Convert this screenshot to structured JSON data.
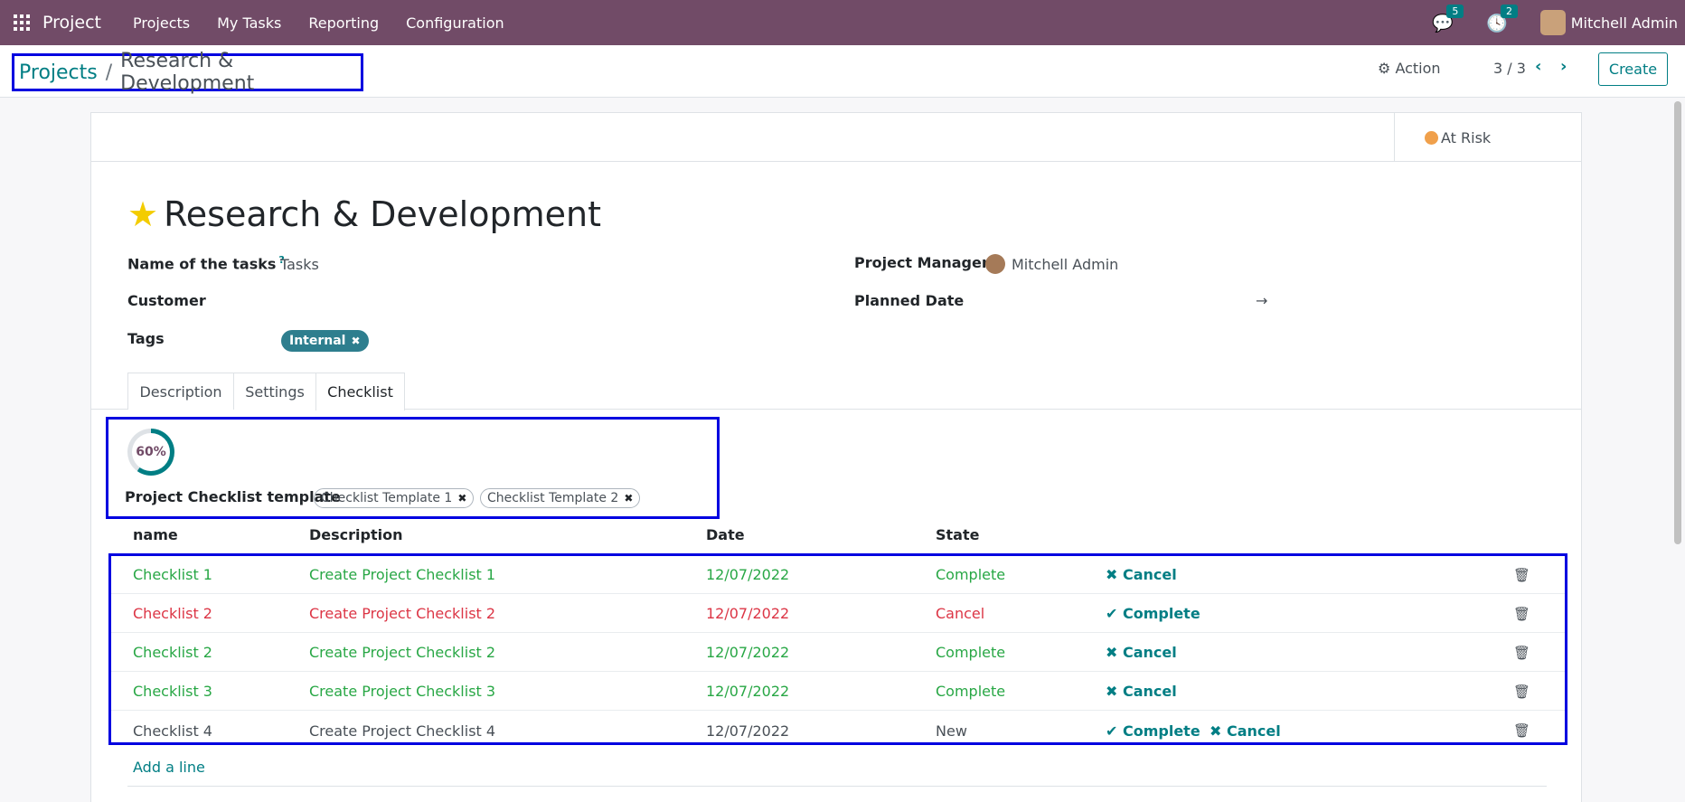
{
  "navbar": {
    "app_name": "Project",
    "menu": [
      "Projects",
      "My Tasks",
      "Reporting",
      "Configuration"
    ],
    "messages_count": "5",
    "activities_count": "2",
    "user_name": "Mitchell Admin"
  },
  "control": {
    "breadcrumb_parent": "Projects",
    "breadcrumb_sep": "/",
    "breadcrumb_current": "Research & Development",
    "action_label": "Action",
    "pager": "3 / 3",
    "create_label": "Create"
  },
  "form": {
    "status": "At Risk",
    "title": "Research & Development",
    "fields": {
      "tasks_label": "Name of the tasks",
      "tasks_help": "?",
      "tasks_value": "Tasks",
      "customer_label": "Customer",
      "tags_label": "Tags",
      "tag": "Internal",
      "pm_label": "Project Manager",
      "pm_value": "Mitchell Admin",
      "planned_label": "Planned Date",
      "planned_arrow": "→"
    },
    "tabs": [
      "Description",
      "Settings",
      "Checklist"
    ],
    "active_tab": "Checklist"
  },
  "checklist": {
    "progress": 60,
    "progress_label": "60%",
    "template_label": "Project Checklist template",
    "templates": [
      "Checklist Template 1",
      "Checklist Template 2"
    ],
    "columns": [
      "name",
      "Description",
      "Date",
      "State"
    ],
    "rows": [
      {
        "name": "Checklist 1",
        "description": "Create Project Checklist 1",
        "date": "12/07/2022",
        "state": "Complete",
        "style": "green",
        "actions": [
          "Cancel"
        ]
      },
      {
        "name": "Checklist 2",
        "description": "Create Project Checklist 2",
        "date": "12/07/2022",
        "state": "Cancel",
        "style": "red",
        "actions": [
          "Complete"
        ]
      },
      {
        "name": "Checklist 2",
        "description": "Create Project Checklist 2",
        "date": "12/07/2022",
        "state": "Complete",
        "style": "green",
        "actions": [
          "Cancel"
        ]
      },
      {
        "name": "Checklist 3",
        "description": "Create Project Checklist 3",
        "date": "12/07/2022",
        "state": "Complete",
        "style": "green",
        "actions": [
          "Cancel"
        ]
      },
      {
        "name": "Checklist 4",
        "description": "Create Project Checklist 4",
        "date": "12/07/2022",
        "state": "New",
        "style": "gray",
        "actions": [
          "Complete",
          "Cancel"
        ]
      }
    ],
    "add_line": "Add a line"
  },
  "colors": {
    "navbar": "#714b67",
    "accent": "#017e84",
    "complete": "#28a745",
    "cancel": "#dc3545",
    "highlight_box": "#0000e0"
  }
}
